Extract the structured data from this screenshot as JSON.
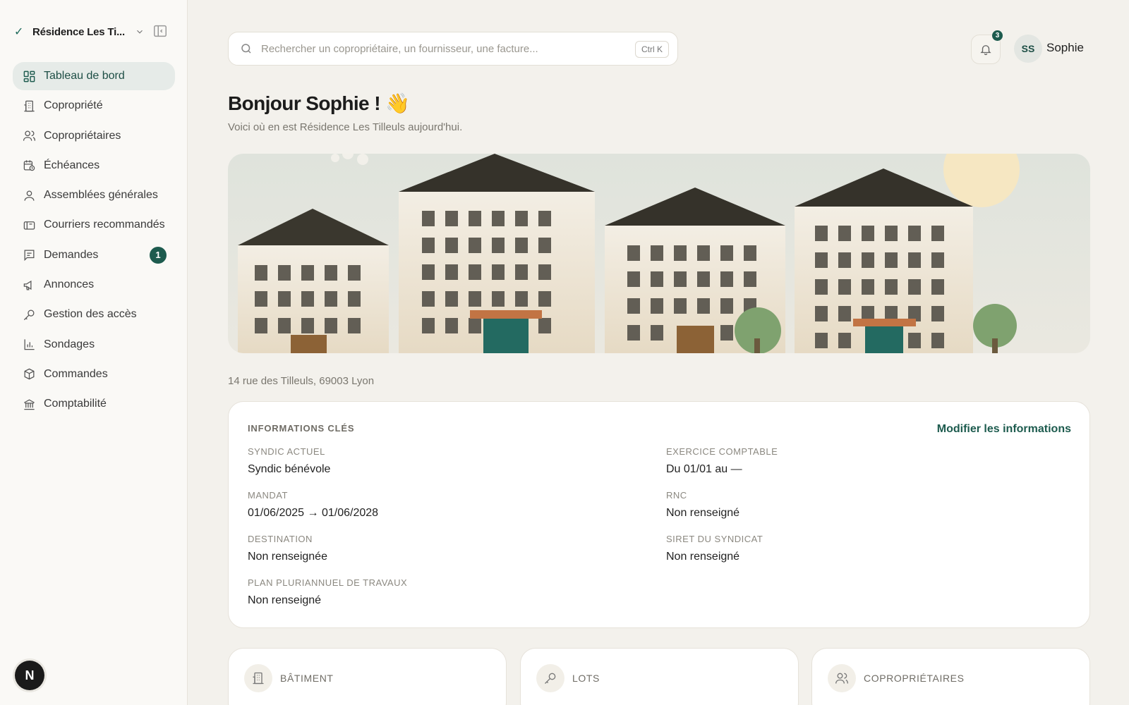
{
  "sidebar": {
    "property_name": "Résidence Les Ti...",
    "items": [
      {
        "label": "Tableau de bord",
        "icon": "dashboard-icon",
        "active": true
      },
      {
        "label": "Copropriété",
        "icon": "building-icon"
      },
      {
        "label": "Copropriétaires",
        "icon": "users-icon"
      },
      {
        "label": "Échéances",
        "icon": "calendar-clock-icon"
      },
      {
        "label": "Assemblées générales",
        "icon": "user-icon"
      },
      {
        "label": "Courriers recommandés",
        "icon": "mailbox-icon"
      },
      {
        "label": "Demandes",
        "icon": "message-icon",
        "badge": "1"
      },
      {
        "label": "Annonces",
        "icon": "megaphone-icon"
      },
      {
        "label": "Gestion des accès",
        "icon": "key-icon"
      },
      {
        "label": "Sondages",
        "icon": "bar-chart-icon"
      },
      {
        "label": "Commandes",
        "icon": "package-icon"
      },
      {
        "label": "Comptabilité",
        "icon": "bank-icon"
      }
    ],
    "footer_logo": "N"
  },
  "header": {
    "search_placeholder": "Rechercher un copropriétaire, un fournisseur, une facture...",
    "shortcut": "Ctrl K",
    "notifications_count": "3",
    "user_initials": "SS",
    "user_name": "Sophie"
  },
  "main": {
    "greeting": "Bonjour Sophie ! 👋",
    "subtitle": "Voici où en est Résidence Les Tilleuls aujourd'hui.",
    "address": "14 rue des Tilleuls, 69003 Lyon",
    "info_card": {
      "title": "INFORMATIONS CLÉS",
      "edit_label": "Modifier les informations",
      "fields": [
        {
          "label": "SYNDIC ACTUEL",
          "value": "Syndic bénévole"
        },
        {
          "label": "EXERCICE COMPTABLE",
          "value": "Du 01/01 au —"
        },
        {
          "label": "MANDAT",
          "value": "01/06/2025 → 01/06/2028"
        },
        {
          "label": "RNC",
          "value": "Non renseigné"
        },
        {
          "label": "DESTINATION",
          "value": "Non renseignée"
        },
        {
          "label": "SIRET DU SYNDICAT",
          "value": "Non renseigné"
        },
        {
          "label": "PLAN PLURIANNUEL DE TRAVAUX",
          "value": "Non renseigné"
        }
      ]
    },
    "stats": [
      {
        "label": "BÂTIMENT",
        "icon": "building-icon"
      },
      {
        "label": "LOTS",
        "icon": "key-icon"
      },
      {
        "label": "COPROPRIÉTAIRES",
        "icon": "users-icon"
      }
    ]
  },
  "colors": {
    "accent": "#1d5b4e",
    "background": "#f3f1ec",
    "sidebar": "#faf9f6"
  }
}
